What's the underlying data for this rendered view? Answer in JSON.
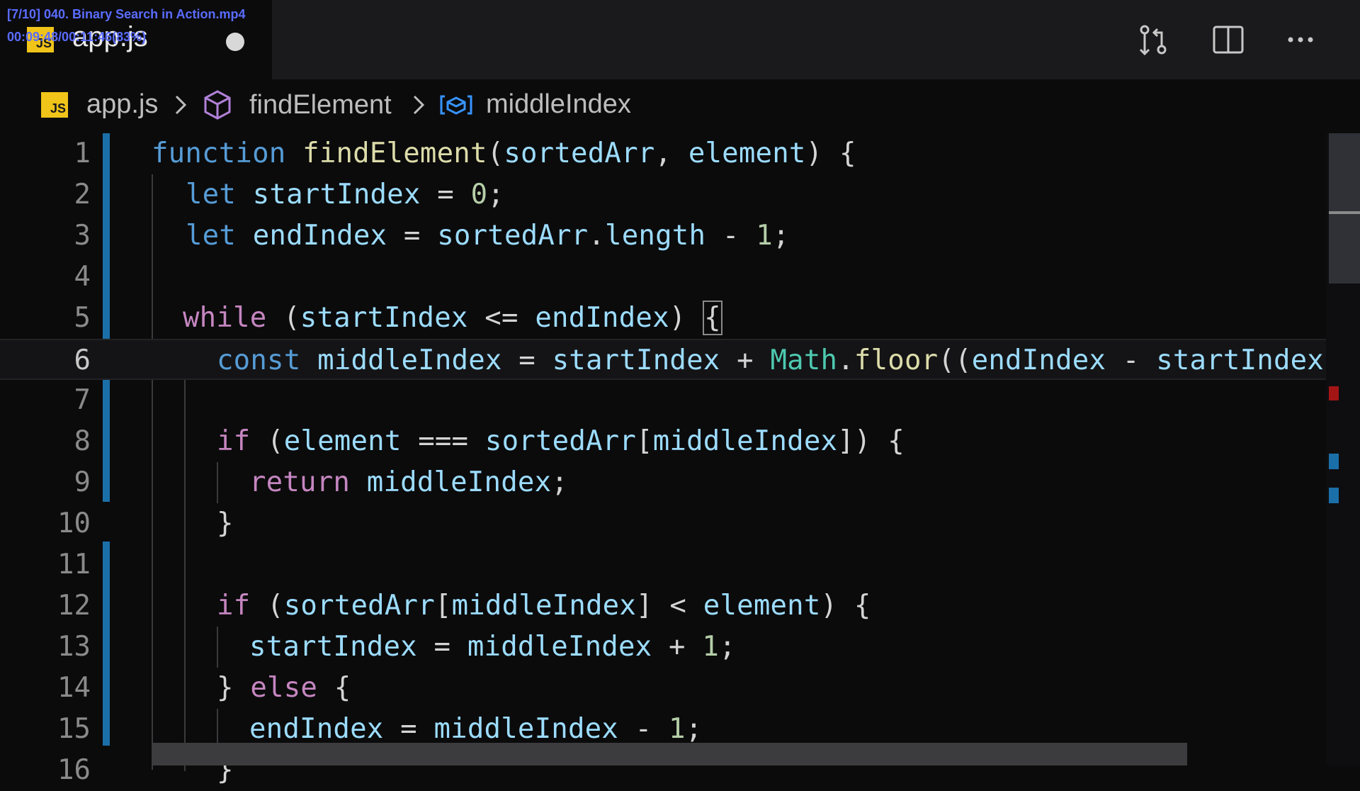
{
  "window": {
    "tab": {
      "filename": "app.js",
      "lang_badge": "JS",
      "dirty": true
    },
    "overlay": {
      "line1": "[7/10] 040. Binary Search in Action.mp4",
      "line2": "00:09:48/00:11:46(83%)"
    },
    "toolbar_icons": [
      "source-control-compare-icon",
      "split-editor-icon",
      "more-actions-icon"
    ]
  },
  "breadcrumb": {
    "file": "app.js",
    "file_badge": "JS",
    "symbol1": "findElement",
    "symbol2": "middleIndex"
  },
  "editor": {
    "line_numbers": [
      "1",
      "2",
      "3",
      "4",
      "5",
      "6",
      "7",
      "8",
      "9",
      "10",
      "11",
      "12",
      "13",
      "14",
      "15",
      "16"
    ],
    "current_line": 6,
    "lines_text": [
      "function findElement(sortedArr, element) {",
      "let startIndex = 0;",
      "let endIndex = sortedArr.length - 1;",
      "",
      "while (startIndex <= endIndex) {",
      "const middleIndex = startIndex + Math.floor((endIndex - startIndex) /",
      "",
      "if (element === sortedArr[middleIndex]) {",
      "return middleIndex;",
      "}",
      "",
      "if (sortedArr[middleIndex] < element) {",
      "startIndex = middleIndex + 1;",
      "} else {",
      "endIndex = middleIndex - 1;",
      "}"
    ]
  },
  "colors": {
    "background": "#0b0b0c",
    "keyword": "#569cd6",
    "control_keyword": "#c586c0",
    "function": "#dcdcaa",
    "variable": "#9cdcfe",
    "number": "#b5cea8",
    "modified_gutter": "#1b6fa8"
  }
}
